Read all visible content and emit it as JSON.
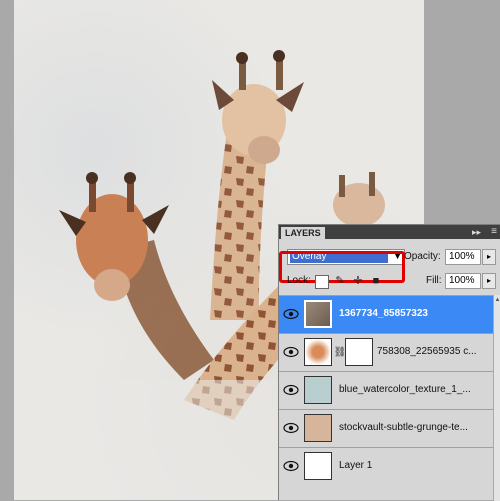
{
  "panel": {
    "tab_label": "LAYERS",
    "collapse_glyph": "▸▸",
    "menu_glyph": "≡"
  },
  "blend": {
    "mode": "Overlay",
    "opacity_label": "Opacity:",
    "opacity_value": "100%"
  },
  "lock": {
    "label": "Lock:",
    "fill_label": "Fill:",
    "fill_value": "100%"
  },
  "layers": [
    {
      "name": "1367734_85857323",
      "active": true,
      "thumb": "giraffe"
    },
    {
      "name": "758308_22565935 c...",
      "active": false,
      "thumb": "masked"
    },
    {
      "name": "blue_watercolor_texture_1_...",
      "active": false,
      "thumb": "blue"
    },
    {
      "name": "stockvault-subtle-grunge-te...",
      "active": false,
      "thumb": "tan"
    },
    {
      "name": "Layer 1",
      "active": false,
      "thumb": "white"
    }
  ],
  "colors": {
    "selection": "#3b89f4",
    "highlight_box": "#e00000",
    "blend_value_bg": "#3f6dd0"
  }
}
